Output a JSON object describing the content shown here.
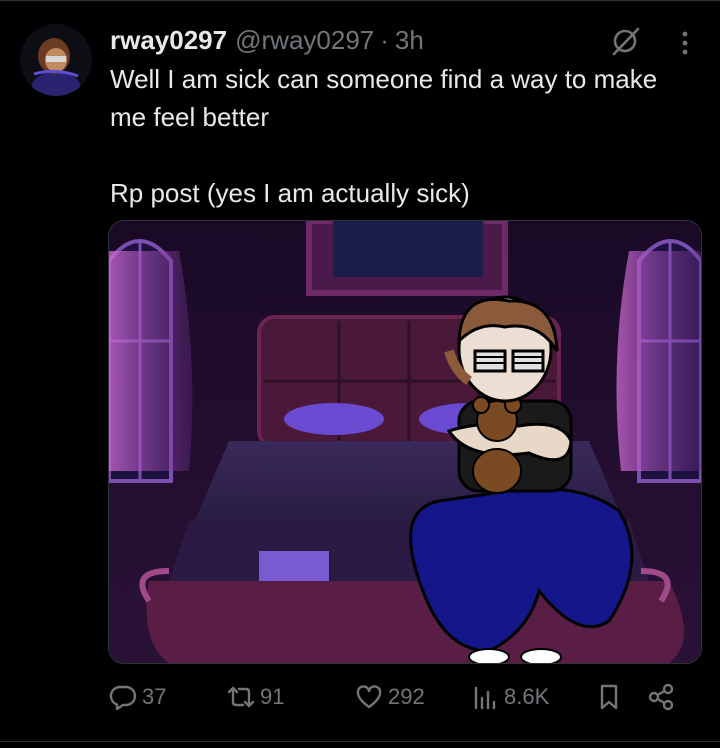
{
  "tweet": {
    "display_name": "rway0297",
    "handle": "@rway0297",
    "separator": "·",
    "time": "3h",
    "text": "Well I am sick can someone find a way to make me feel better\n\nRp post (yes I am actually sick)"
  },
  "actions": {
    "replies": "37",
    "reposts": "91",
    "likes": "292",
    "views": "8.6K"
  },
  "icons": {
    "avatar": "avatar",
    "grok": "grok-icon",
    "more": "more-icon",
    "reply": "reply-icon",
    "repost": "repost-icon",
    "like": "heart-icon",
    "views": "views-icon",
    "bookmark": "bookmark-icon",
    "share": "share-icon"
  },
  "colors": {
    "background": "#000000",
    "text": "#e7e9ea",
    "muted": "#71767b",
    "divider": "#2f3336"
  }
}
